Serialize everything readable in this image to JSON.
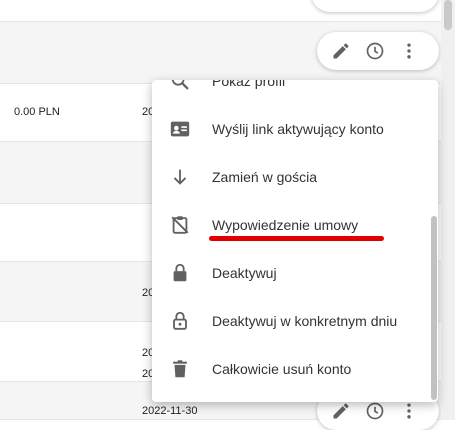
{
  "table": {
    "row_2": {
      "amount": "0.00 PLN",
      "date_partial": "20"
    },
    "row_5": {
      "date_partial": "20"
    },
    "row_6": {
      "date_partial": "20"
    },
    "row_7": {
      "date_partial": "20"
    },
    "row_8": {
      "date": "2022-11-30"
    }
  },
  "row_actions": {
    "icons": [
      "pencil-icon",
      "history-clock-icon",
      "more-vert-icon"
    ]
  },
  "context_menu": {
    "items": [
      {
        "label": "Pokaż profil",
        "icon": "search-icon"
      },
      {
        "label": "Wyślij link aktywujący konto",
        "icon": "id-card-icon"
      },
      {
        "label": "Zamień w gościa",
        "icon": "arrow-down-icon"
      },
      {
        "label": "Wypowiedzenie umowy",
        "icon": "clipboard-off-icon",
        "annotated": true
      },
      {
        "label": "Deaktywuj",
        "icon": "lock-icon"
      },
      {
        "label": "Deaktywuj w konkretnym dniu",
        "icon": "lock-outline-icon"
      },
      {
        "label": "Całkowicie usuń konto",
        "icon": "trash-icon"
      }
    ]
  },
  "colors": {
    "annotation": "#e00000",
    "icon": "#616161",
    "row_alt": "#f5f5f5"
  }
}
